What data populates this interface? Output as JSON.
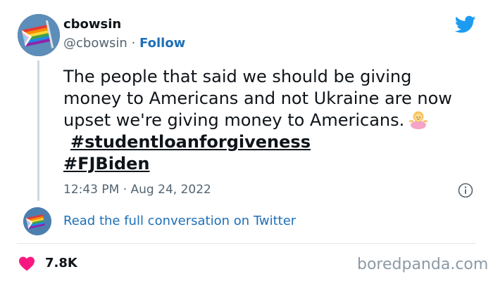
{
  "author": {
    "display_name": "cbowsin",
    "handle": "@cbowsin",
    "separator": "·",
    "follow_label": "Follow"
  },
  "tweet": {
    "line1": "The people that said we should be giving",
    "line2": "money to Americans and not Ukraine are now",
    "line3": "upset we're giving money to Americans.",
    "hashtag1": "#studentloanforgiveness",
    "hashtag2": "#FJBiden",
    "emoji": "person-shrugging-emoji"
  },
  "timestamp": "12:43 PM · Aug 24, 2022",
  "read_link": "Read the full conversation on Twitter",
  "likes": "7.8K",
  "watermark": "boredpanda.com",
  "colors": {
    "link_blue": "#1d6fb8",
    "twitter_blue": "#1d9bf0",
    "heart_red": "#f91880",
    "muted_text": "#536471"
  },
  "icons": {
    "brand": "twitter-bird-icon",
    "info": "info-icon",
    "like": "heart-icon"
  }
}
